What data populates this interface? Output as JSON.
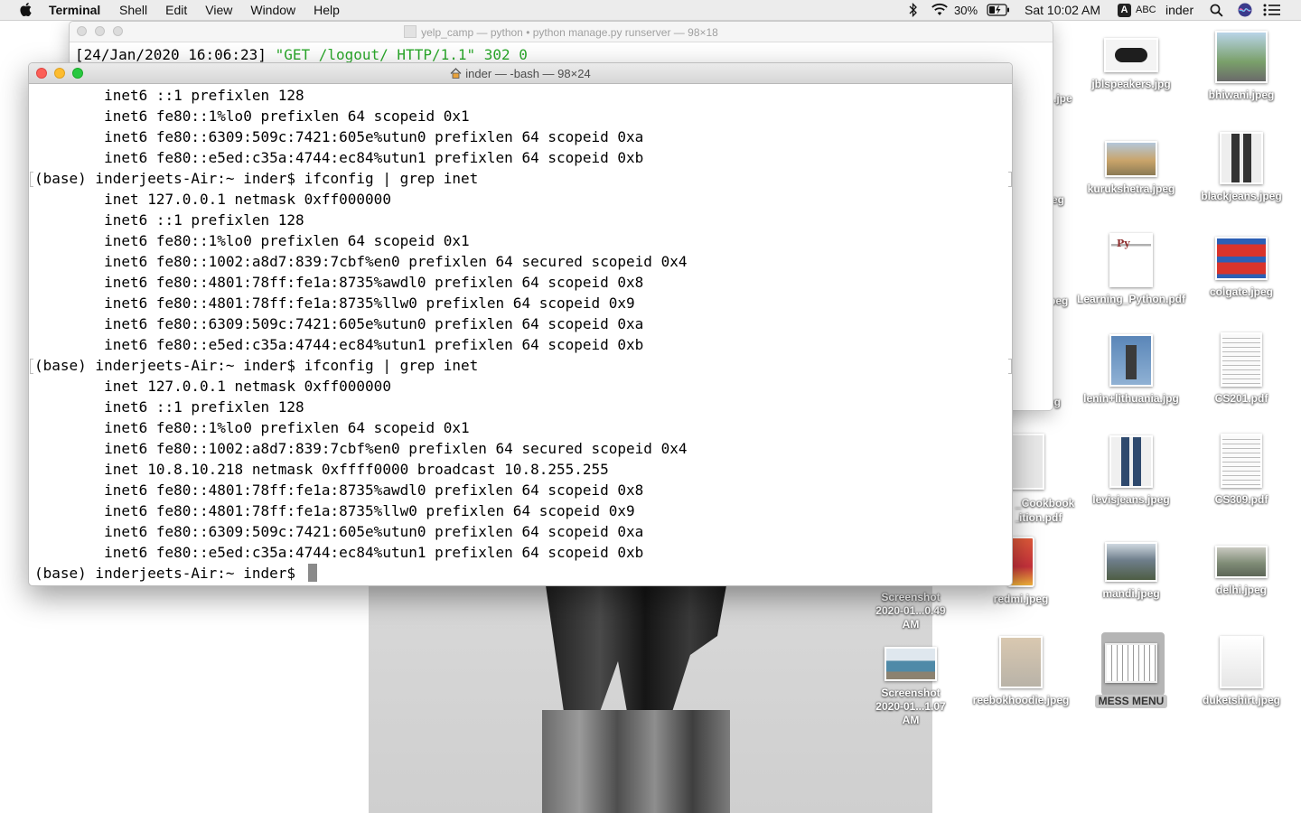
{
  "menubar": {
    "app_name": "Terminal",
    "menus": [
      "Shell",
      "Edit",
      "View",
      "Window",
      "Help"
    ],
    "battery": "30%",
    "clock": "Sat 10:02 AM",
    "input_source_letter": "A",
    "input_source": "ABC",
    "user": "inder",
    "icons": [
      "apple-logo",
      "bluetooth-icon",
      "wifi-icon",
      "battery-icon",
      "search-icon",
      "siri-icon",
      "notification-center-icon"
    ]
  },
  "back_window": {
    "title": "yelp_camp — python • python manage.py runserver — 98×18",
    "log_line_time": "[24/Jan/2020 16:06:23] ",
    "log_line_request": "\"GET /logout/ HTTP/1.1\" 302 0"
  },
  "terminal": {
    "title": "inder — -bash — 98×24",
    "lines": [
      {
        "text": "        inet6 ::1 prefixlen 128",
        "prompt": false
      },
      {
        "text": "        inet6 fe80::1%lo0 prefixlen 64 scopeid 0x1",
        "prompt": false
      },
      {
        "text": "        inet6 fe80::6309:509c:7421:605e%utun0 prefixlen 64 scopeid 0xa",
        "prompt": false
      },
      {
        "text": "        inet6 fe80::e5ed:c35a:4744:ec84%utun1 prefixlen 64 scopeid 0xb",
        "prompt": false
      },
      {
        "text": "(base) inderjeets-Air:~ inder$ ifconfig | grep inet",
        "prompt": true
      },
      {
        "text": "        inet 127.0.0.1 netmask 0xff000000",
        "prompt": false
      },
      {
        "text": "        inet6 ::1 prefixlen 128",
        "prompt": false
      },
      {
        "text": "        inet6 fe80::1%lo0 prefixlen 64 scopeid 0x1",
        "prompt": false
      },
      {
        "text": "        inet6 fe80::1002:a8d7:839:7cbf%en0 prefixlen 64 secured scopeid 0x4",
        "prompt": false
      },
      {
        "text": "        inet6 fe80::4801:78ff:fe1a:8735%awdl0 prefixlen 64 scopeid 0x8",
        "prompt": false
      },
      {
        "text": "        inet6 fe80::4801:78ff:fe1a:8735%llw0 prefixlen 64 scopeid 0x9",
        "prompt": false
      },
      {
        "text": "        inet6 fe80::6309:509c:7421:605e%utun0 prefixlen 64 scopeid 0xa",
        "prompt": false
      },
      {
        "text": "        inet6 fe80::e5ed:c35a:4744:ec84%utun1 prefixlen 64 scopeid 0xb",
        "prompt": false
      },
      {
        "text": "(base) inderjeets-Air:~ inder$ ifconfig | grep inet",
        "prompt": true
      },
      {
        "text": "        inet 127.0.0.1 netmask 0xff000000",
        "prompt": false
      },
      {
        "text": "        inet6 ::1 prefixlen 128",
        "prompt": false
      },
      {
        "text": "        inet6 fe80::1%lo0 prefixlen 64 scopeid 0x1",
        "prompt": false
      },
      {
        "text": "        inet6 fe80::1002:a8d7:839:7cbf%en0 prefixlen 64 secured scopeid 0x4",
        "prompt": false
      },
      {
        "text": "        inet 10.8.10.218 netmask 0xffff0000 broadcast 10.8.255.255",
        "prompt": false
      },
      {
        "text": "        inet6 fe80::4801:78ff:fe1a:8735%awdl0 prefixlen 64 scopeid 0x8",
        "prompt": false
      },
      {
        "text": "        inet6 fe80::4801:78ff:fe1a:8735%llw0 prefixlen 64 scopeid 0x9",
        "prompt": false
      },
      {
        "text": "        inet6 fe80::6309:509c:7421:605e%utun0 prefixlen 64 scopeid 0xa",
        "prompt": false
      },
      {
        "text": "        inet6 fe80::e5ed:c35a:4744:ec84%utun1 prefixlen 64 scopeid 0xb",
        "prompt": false
      }
    ],
    "current_prompt": "(base) inderjeets-Air:~ inder$ "
  },
  "desktop": {
    "partial_labels": [
      ".jpe",
      "eg",
      "peg",
      "shirt.jpeg",
      "_Cookbook_",
      "ition.pdf"
    ],
    "icons": [
      {
        "label": "jblspeakers.jpg",
        "thumb": "#2a2a2a"
      },
      {
        "label": "bhiwani.jpeg",
        "thumb": "#7aa06a"
      },
      {
        "label": "kurukshetra.jpeg",
        "thumb": "#c9a46a"
      },
      {
        "label": "blackjeans.jpeg",
        "thumb": "#3a3a3a"
      },
      {
        "label": "Learning_Python.pdf",
        "thumb": "#f2f2f2"
      },
      {
        "label": "colgate.jpeg",
        "thumb": "#d9342b"
      },
      {
        "label": "lenin+lithuania.jpg",
        "thumb": "#5a86b8"
      },
      {
        "label": "CS201.pdf",
        "thumb": "#f4f4f4"
      },
      {
        "label": "levisjeans.jpeg",
        "thumb": "#2f4a6e"
      },
      {
        "label": "CS309.pdf",
        "thumb": "#f4f4f4"
      },
      {
        "label": "redmi.jpeg",
        "thumb": "#c8323c"
      },
      {
        "label": "mandi.jpeg",
        "thumb": "#6f7f8c"
      },
      {
        "label": "delhi.jpeg",
        "thumb": "#7f8c76"
      },
      {
        "label": "Screenshot 2020-01...0.49 AM",
        "thumb": "#cccccc"
      },
      {
        "label": "Screenshot 2020-01...1.07 AM",
        "thumb": "#4f8aa8"
      },
      {
        "label": "reebokhoodie.jpeg",
        "thumb": "#b9b3a8"
      },
      {
        "label": "MESS MENU",
        "thumb": "#e8e8e8"
      },
      {
        "label": "duketshirt.jpeg",
        "thumb": "#ffffff"
      }
    ]
  }
}
